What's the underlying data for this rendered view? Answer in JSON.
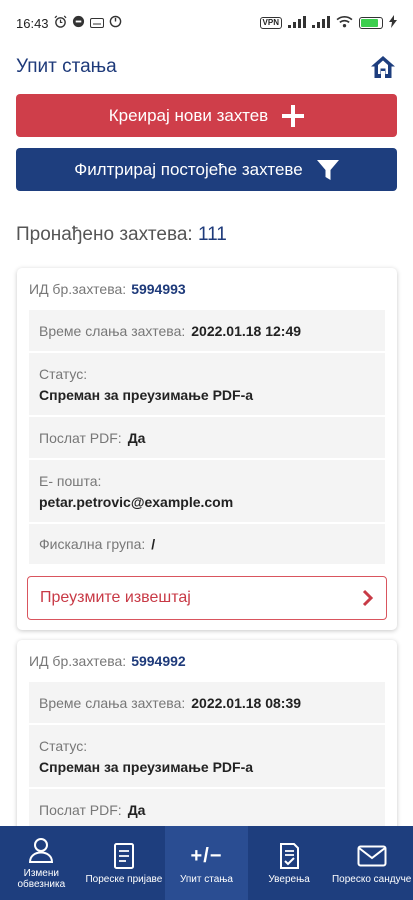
{
  "status_bar": {
    "time": "16:43",
    "vpn": "VPN"
  },
  "header": {
    "title": "Упит стања"
  },
  "actions": {
    "create_label": "Креирај нови захтев",
    "filter_label": "Филтрирај постојеће захтеве"
  },
  "results": {
    "label": "Пронађено захтева:",
    "count": "111"
  },
  "requests": [
    {
      "id_label": "ИД бр.захтева:",
      "id": "5994993",
      "sent_time_label": "Време слања захтева:",
      "sent_time": "2022.01.18 12:49",
      "status_label": "Статус:",
      "status": "Спреман за преузимање PDF-а",
      "pdf_sent_label": "Послат PDF:",
      "pdf_sent": "Да",
      "email_label": "Е- пошта:",
      "email": "petar.petrovic@example.com",
      "fiscal_group_label": "Фискална група:",
      "fiscal_group": "/",
      "download_label": "Преузмите извештај"
    },
    {
      "id_label": "ИД бр.захтева:",
      "id": "5994992",
      "sent_time_label": "Време слања захтева:",
      "sent_time": "2022.01.18 08:39",
      "status_label": "Статус:",
      "status": "Спреман за преузимање PDF-а",
      "pdf_sent_label": "Послат PDF:",
      "pdf_sent": "Да"
    }
  ],
  "nav": [
    {
      "label": "Измени обвезника",
      "icon": "user-icon"
    },
    {
      "label": "Пореске пријаве",
      "icon": "document-icon"
    },
    {
      "label": "Упит стања",
      "icon": "plus-minus-icon",
      "symbol": "+/−",
      "active": true
    },
    {
      "label": "Уверења",
      "icon": "certificate-check-icon"
    },
    {
      "label": "Пореско сандуче",
      "icon": "envelope-icon"
    }
  ],
  "colors": {
    "primary": "#1e3e7e",
    "danger": "#cf3e4a",
    "accent_text": "#1e3a7a"
  }
}
